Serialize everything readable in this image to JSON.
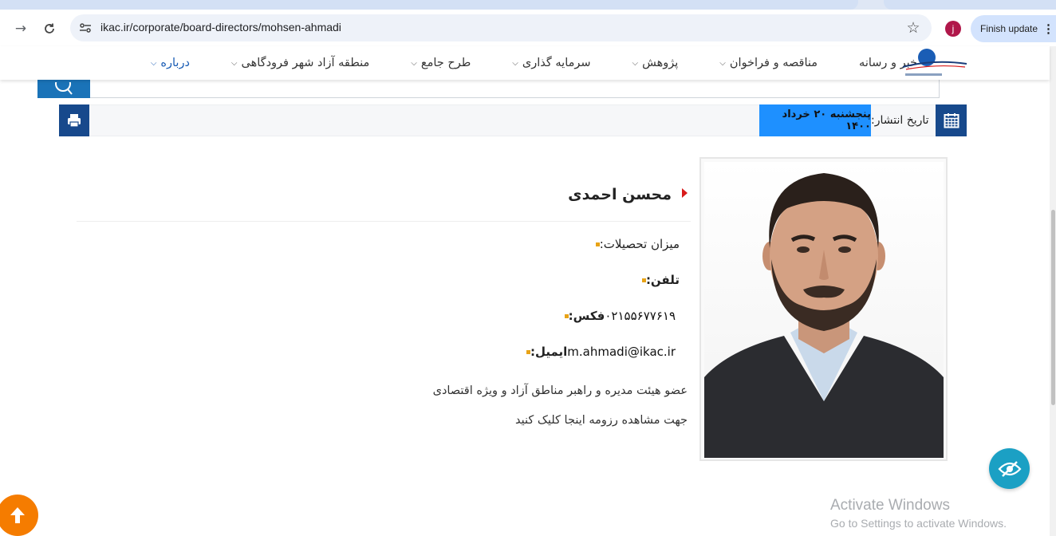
{
  "browser": {
    "url": "ikac.ir/corporate/board-directors/mohsen-ahmadi",
    "profile_initial": "j",
    "finish_update_label": "Finish update"
  },
  "nav": {
    "items": [
      {
        "label": "درباره",
        "active": true
      },
      {
        "label": "منطقه آزاد شهر فرودگاهی"
      },
      {
        "label": "طرح جامع"
      },
      {
        "label": "سرمایه گذاری"
      },
      {
        "label": "پژوهش"
      },
      {
        "label": "مناقصه و فراخوان"
      },
      {
        "label": "خبر و رسانه"
      }
    ]
  },
  "date_bar": {
    "label": "تاریخ انتشار:",
    "value": "پنجشنبه ۲۰ خرداد ۱۴۰۰"
  },
  "profile": {
    "name": "محسن احمدی",
    "education_label": "میزان تحصیلات:",
    "phone_label": "تلفن:",
    "fax_label": "فکس:",
    "fax_value": "۰۲۱۵۵۶۷۷۶۱۹",
    "email_label": "ایمیل:",
    "email_value": "m.ahmadi@ikac.ir",
    "role": "عضو هیئت مدیره و راهبر مناطق آزاد و ویژه اقتصادی",
    "resume_link": "جهت مشاهده رزومه اینجا کلیک کنید"
  },
  "watermark": {
    "title": "Activate Windows",
    "subtitle": "Go to Settings to activate Windows."
  },
  "colors": {
    "primary_blue": "#17498c",
    "date_highlight": "#1e90ff",
    "bullet": "#e8a317",
    "marker_red": "#d81b1b",
    "accessibility": "#1ba0c4",
    "scroll_top": "#f57c00"
  }
}
